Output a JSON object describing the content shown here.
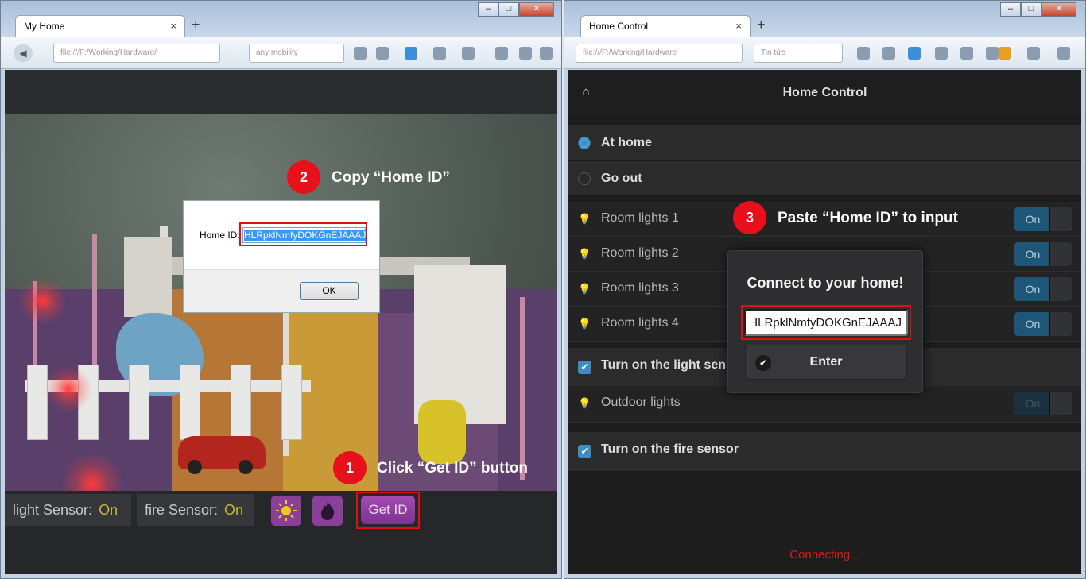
{
  "left_window": {
    "tab_title": "My Home",
    "tab_close": "×",
    "new_tab": "+",
    "url_text": "file:///F:/Working/Hardware/",
    "search_text": "any mobility",
    "window_controls": {
      "minimize": "–",
      "maximize": "□",
      "close": "✕"
    }
  },
  "right_window": {
    "tab_title": "Home Control",
    "tab_close": "×",
    "new_tab": "+",
    "url_text": "file:///F:/Working/Hardware",
    "search_text": "Tin tức",
    "window_controls": {
      "minimize": "–",
      "maximize": "□",
      "close": "✕"
    }
  },
  "dialog": {
    "label": "Home ID:",
    "value": "HLRpklNmfyDOKGnEJAAAJ",
    "ok_label": "OK"
  },
  "left_bottom": {
    "light_sensor_label": "light Sensor:",
    "light_sensor_value": "On",
    "fire_sensor_label": "fire Sensor:",
    "fire_sensor_value": "On",
    "get_id_label": "Get ID"
  },
  "steps": [
    {
      "number": "1",
      "text": "Click “Get ID” button"
    },
    {
      "number": "2",
      "text": "Copy “Home ID”"
    },
    {
      "number": "3",
      "text": "Paste “Home ID” to input"
    }
  ],
  "home_control": {
    "title": "Home Control",
    "modes": [
      {
        "label": "At home",
        "selected": true
      },
      {
        "label": "Go out",
        "selected": false
      }
    ],
    "room_lights": [
      {
        "label": "Room lights 1",
        "state": "On"
      },
      {
        "label": "Room lights 2",
        "state": "On"
      },
      {
        "label": "Room lights 3",
        "state": "On"
      },
      {
        "label": "Room lights 4",
        "state": "On"
      }
    ],
    "light_sensor_check": "Turn on the light sensor",
    "outdoor_lights": {
      "label": "Outdoor lights",
      "state": "On"
    },
    "fire_sensor_check": "Turn on the fire sensor",
    "status": "Connecting..."
  },
  "connect_popup": {
    "title": "Connect to your home!",
    "input_value": "HLRpklNmfyDOKGnEJAAAJ",
    "enter_label": "Enter"
  },
  "colors": {
    "step_red": "#e8101a",
    "toggle_blue": "#1e5678",
    "accent_blue": "#3b8ec4",
    "get_id_purple": "#9a44aa",
    "sensor_value_yellow": "#c8b83a",
    "status_red": "#e01818"
  }
}
